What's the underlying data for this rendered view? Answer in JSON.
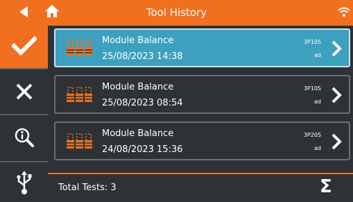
{
  "header": {
    "title": "Tool History",
    "back_icon": "back-arrow-icon",
    "home_icon": "home-icon",
    "status_icon": "wifi-icon"
  },
  "sidebar": {
    "items": [
      {
        "icon": "checkmark-icon",
        "action": "confirm"
      },
      {
        "icon": "close-icon",
        "action": "cancel"
      },
      {
        "icon": "zoom-info-icon",
        "action": "details"
      },
      {
        "icon": "usb-icon",
        "action": "export"
      }
    ]
  },
  "tests": [
    {
      "name": "Module Balance",
      "date": "25/08/2023 14:38",
      "code": "3P10S",
      "unit": "ad",
      "selected": true
    },
    {
      "name": "Module Balance",
      "date": "25/08/2023 08:54",
      "code": "3P10S",
      "unit": "ad",
      "selected": false
    },
    {
      "name": "Module Balance",
      "date": "24/08/2023 15:36",
      "code": "3P20S",
      "unit": "ad",
      "selected": false
    }
  ],
  "footer": {
    "total_label": "Total Tests: 3",
    "sigma": "Σ"
  },
  "colors": {
    "accent": "#f07020",
    "panel": "#2e3236",
    "selected": "#3ea0bf"
  }
}
